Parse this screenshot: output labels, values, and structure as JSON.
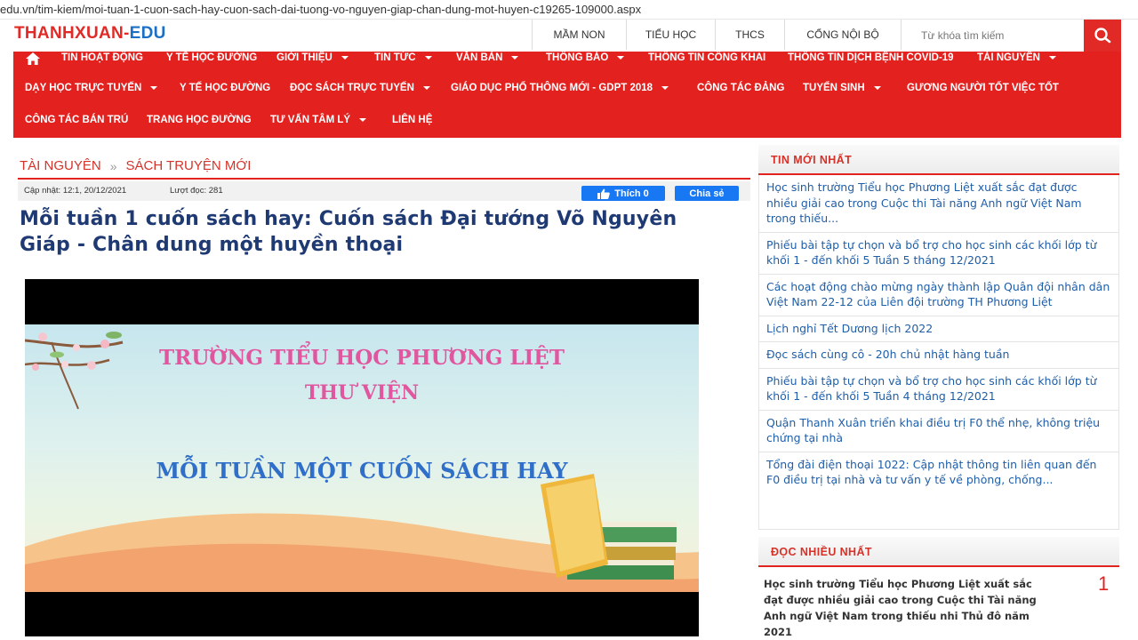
{
  "browser": {
    "url": "edu.vn/tim-kiem/moi-tuan-1-cuon-sach-hay-cuon-sach-dai-tuong-vo-nguyen-giap-chan-dung-mot-huyen-c19265-109000.aspx"
  },
  "header": {
    "logo_part1": "THANHXUAN-",
    "logo_part2": "EDU",
    "top_links": [
      "MẦM NON",
      "TIỂU HỌC",
      "THCS",
      "CỔNG NỘI BỘ"
    ],
    "search_placeholder": "Từ khóa tìm kiếm"
  },
  "nav": {
    "row1": [
      "TIN HOẠT ĐỘNG",
      "Y TẾ HỌC ĐƯỜNG",
      "GIỚI THIỆU",
      "TIN TỨC",
      "VĂN BẢN",
      "THÔNG BÁO",
      "THÔNG TIN CÔNG KHAI",
      "THÔNG TIN DỊCH BỆNH COVID-19",
      "TÀI NGUYÊN"
    ],
    "row2": [
      "DẠY HỌC TRỰC TUYẾN",
      "Y TẾ HỌC ĐƯỜNG",
      "ĐỌC SÁCH TRỰC TUYẾN",
      "GIÁO DỤC PHỔ THÔNG MỚI - GDPT 2018",
      "CÔNG TÁC ĐẢNG",
      "TUYỂN SINH",
      "GƯƠNG NGƯỜI TỐT VIỆC TỐT"
    ],
    "row3": [
      "CÔNG TÁC BÁN TRÚ",
      "TRANG HỌC ĐƯỜNG",
      "TƯ VẤN TÂM LÝ",
      "LIÊN HỆ"
    ]
  },
  "article": {
    "breadcrumb": [
      "TÀI NGUYÊN",
      "SÁCH TRUYỆN MỚI"
    ],
    "updated": "Cập nhật: 12:1, 20/12/2021",
    "views": "Lượt đọc: 281",
    "like_label": "Thích 0",
    "share_label": "Chia sẻ",
    "title": "Mỗi tuần 1 cuốn sách hay: Cuốn sách Đại tướng Võ Nguyên Giáp - Chân dung một huyền thoại",
    "video": {
      "line1": "TRƯỜNG TIỂU HỌC PHƯƠNG LIỆT",
      "line2": "THƯ VIỆN",
      "line3": "MỖI TUẦN MỘT CUỐN SÁCH HAY"
    }
  },
  "sidebar": {
    "latest_title": "TIN MỚI NHẤT",
    "latest": [
      "Học sinh trường Tiểu học Phương Liệt xuất sắc đạt được nhiều giải cao trong Cuộc thi Tài năng Anh ngữ Việt Nam trong thiếu...",
      "Phiếu bài tập tự chọn và bổ trợ cho học sinh các khối lớp từ khối 1 - đến khối 5 Tuần 5 tháng 12/2021",
      "Các hoạt động chào mừng ngày thành lập Quân đội nhân dân Việt Nam 22-12 của Liên đội trường TH Phương Liệt",
      "Lịch nghỉ Tết Dương lịch 2022",
      "Đọc sách cùng cô - 20h chủ nhật hàng tuần",
      "Phiếu bài tập tự chọn và bổ trợ cho học sinh các khối lớp từ khối 1 - đến khối 5 Tuần 4 tháng 12/2021",
      "Quận Thanh Xuân triển khai điều trị F0 thể nhẹ, không triệu chứng tại nhà",
      "Tổng đài điện thoại 1022: Cập nhật thông tin liên quan đến F0 điều trị tại nhà và tư vấn y tế về phòng, chống..."
    ],
    "popular_title": "ĐỌC NHIỀU NHẤT",
    "popular_item": "Học sinh trường Tiểu học Phương Liệt xuất sắc đạt được nhiều giải cao trong Cuộc thi Tài năng Anh ngữ Việt Nam trong thiếu nhi Thủ đô năm 2021",
    "popular_rank": "1"
  },
  "colors": {
    "brand_red": "#e3211f",
    "brand_blue": "#1b6fc4",
    "link_blue": "#1f5ea8",
    "facebook_blue": "#1877f2"
  },
  "icons": [
    "home-icon",
    "search-icon",
    "thumbs-up-icon",
    "caret-down-icon",
    "play-icon"
  ]
}
